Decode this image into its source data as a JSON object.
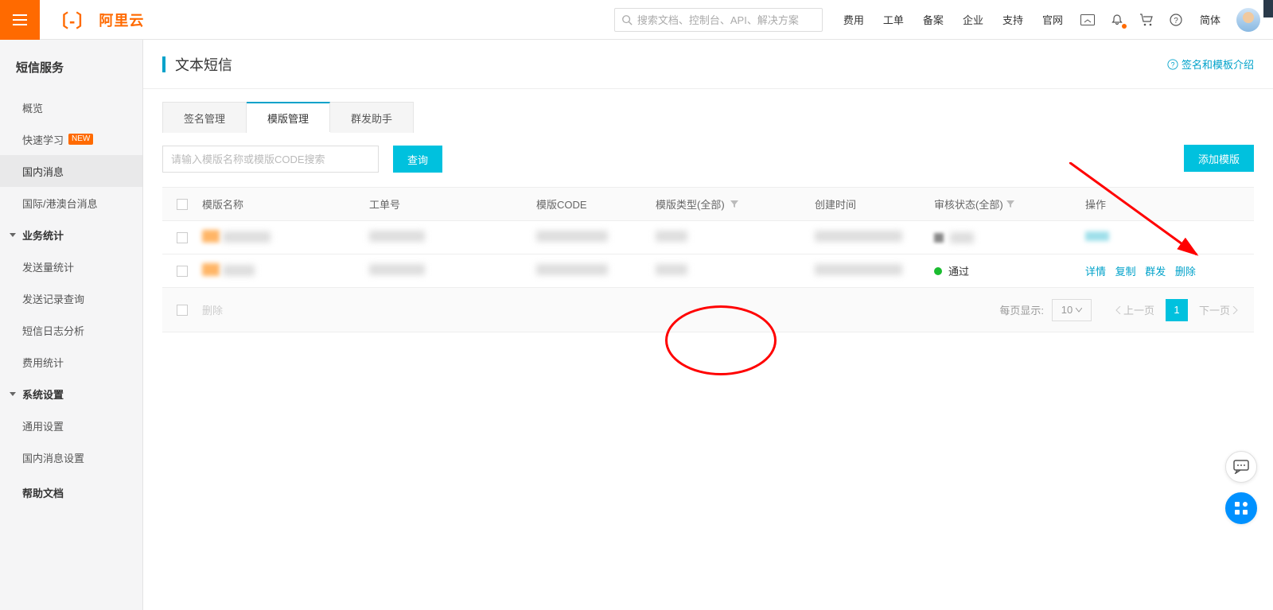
{
  "header": {
    "brand": "阿里云",
    "search_placeholder": "搜索文档、控制台、API、解决方案",
    "links": [
      "费用",
      "工单",
      "备案",
      "企业",
      "支持",
      "官网"
    ],
    "lang": "简体"
  },
  "sidebar": {
    "title": "短信服务",
    "items": [
      {
        "label": "概览",
        "type": "item"
      },
      {
        "label": "快速学习",
        "type": "item",
        "badge": "NEW"
      },
      {
        "label": "国内消息",
        "type": "item",
        "active": true
      },
      {
        "label": "国际/港澳台消息",
        "type": "item"
      },
      {
        "label": "业务统计",
        "type": "cat"
      },
      {
        "label": "发送量统计",
        "type": "item"
      },
      {
        "label": "发送记录查询",
        "type": "item"
      },
      {
        "label": "短信日志分析",
        "type": "item"
      },
      {
        "label": "费用统计",
        "type": "item"
      },
      {
        "label": "系统设置",
        "type": "cat"
      },
      {
        "label": "通用设置",
        "type": "item"
      },
      {
        "label": "国内消息设置",
        "type": "item"
      },
      {
        "label": "帮助文档",
        "type": "top"
      }
    ]
  },
  "page": {
    "title": "文本短信",
    "help_link": "签名和模板介绍"
  },
  "tabs": [
    {
      "label": "签名管理",
      "active": false
    },
    {
      "label": "模版管理",
      "active": true
    },
    {
      "label": "群发助手",
      "active": false
    }
  ],
  "toolbar": {
    "search_placeholder": "请输入模版名称或模版CODE搜索",
    "query_label": "查询",
    "add_label": "添加模版"
  },
  "table": {
    "columns": {
      "name": "模版名称",
      "order": "工单号",
      "code": "模版CODE",
      "type": "模版类型(全部)",
      "time": "创建时间",
      "status": "审核状态(全部)",
      "ops": "操作"
    },
    "rows": [
      {
        "status_label": "",
        "status_kind": "redacted"
      },
      {
        "status_label": "通过",
        "status_kind": "pass",
        "ops": [
          "详情",
          "复制",
          "群发",
          "删除"
        ]
      }
    ]
  },
  "footer": {
    "delete_label": "删除",
    "per_page_label": "每页显示:",
    "page_size": "10",
    "prev": "上一页",
    "next": "下一页",
    "current": "1"
  }
}
